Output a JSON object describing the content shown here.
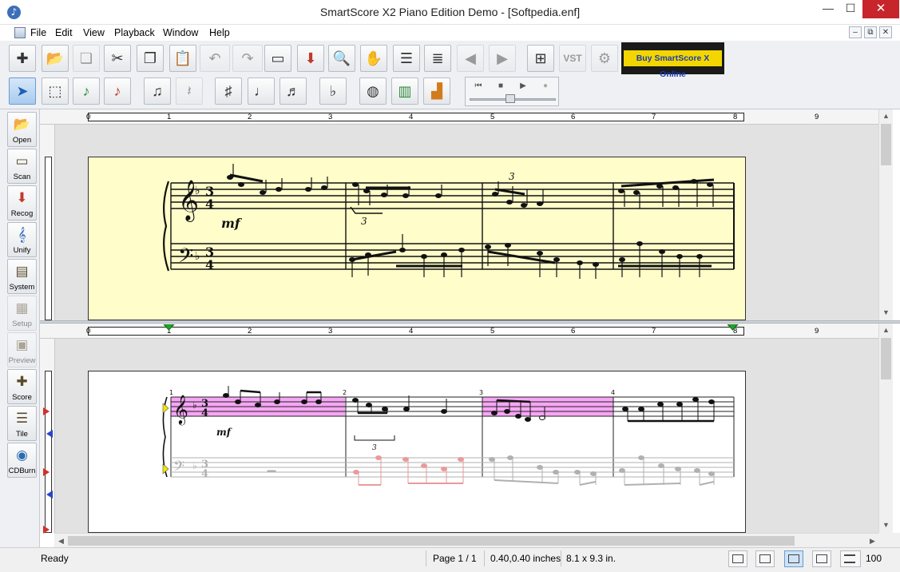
{
  "window": {
    "title": "SmartScore X2 Piano Edition Demo - [Softpedia.enf]",
    "controls": {
      "minimize": "—",
      "maximize": "☐",
      "close": "✕"
    }
  },
  "menu": {
    "items": [
      "File",
      "Edit",
      "View",
      "Playback",
      "Window",
      "Help"
    ],
    "mdi": {
      "minimize": "–",
      "restore": "⧉",
      "close": "✕"
    }
  },
  "toolbar": {
    "row1": [
      {
        "id": "new",
        "icon": "new-score-icon",
        "glyph": "✚"
      },
      {
        "id": "open",
        "icon": "open-folder-icon",
        "glyph": "📂"
      },
      {
        "id": "close",
        "icon": "close-file-icon",
        "glyph": "❏"
      },
      {
        "id": "cut",
        "icon": "scissors-icon",
        "glyph": "✂"
      },
      {
        "id": "copy",
        "icon": "copy-icon",
        "glyph": "❐"
      },
      {
        "id": "paste",
        "icon": "paste-icon",
        "glyph": "📋"
      },
      {
        "id": "undo",
        "icon": "undo-icon",
        "glyph": "↶"
      },
      {
        "id": "redo",
        "icon": "redo-icon",
        "glyph": "↷"
      },
      {
        "id": "scan",
        "icon": "scanner-icon",
        "glyph": "▭"
      },
      {
        "id": "recognize",
        "icon": "recognize-icon",
        "glyph": "⬇"
      },
      {
        "id": "zoom",
        "icon": "magnifier-icon",
        "glyph": "🔍"
      },
      {
        "id": "hand",
        "icon": "hand-icon",
        "glyph": "✋"
      },
      {
        "id": "page-view",
        "icon": "page-view-icon",
        "glyph": "☰"
      },
      {
        "id": "staff-view",
        "icon": "staff-view-icon",
        "glyph": "≣"
      },
      {
        "id": "prev-page",
        "icon": "prev-page-icon",
        "glyph": "◀"
      },
      {
        "id": "next-page",
        "icon": "next-page-icon",
        "glyph": "▶"
      },
      {
        "id": "mixer",
        "icon": "mixer-icon",
        "glyph": "⊞"
      },
      {
        "id": "vst",
        "icon": "vst-icon",
        "glyph": "VST"
      },
      {
        "id": "tuner",
        "icon": "tuner-icon",
        "glyph": "⚙"
      }
    ],
    "row2": [
      {
        "id": "select",
        "icon": "arrow-pointer-icon",
        "glyph": "➤"
      },
      {
        "id": "select-region",
        "icon": "select-region-icon",
        "glyph": "⬚"
      },
      {
        "id": "insert",
        "icon": "insert-note-icon",
        "glyph": "♪"
      },
      {
        "id": "delete",
        "icon": "delete-note-icon",
        "glyph": "♪"
      },
      {
        "id": "notes",
        "icon": "notes-palette-icon",
        "glyph": "♫"
      },
      {
        "id": "rests",
        "icon": "rests-palette-icon",
        "glyph": "𝄽"
      },
      {
        "id": "accidentals",
        "icon": "accidentals-icon",
        "glyph": "♯"
      },
      {
        "id": "durations",
        "icon": "duration-icon",
        "glyph": "♩"
      },
      {
        "id": "tuplets",
        "icon": "tuplet-icon",
        "glyph": "♬"
      },
      {
        "id": "ties",
        "icon": "ties-icon",
        "glyph": "♭"
      },
      {
        "id": "drum",
        "icon": "drum-icon",
        "glyph": "◍"
      },
      {
        "id": "piano-roll",
        "icon": "piano-roll-icon",
        "glyph": "▥"
      },
      {
        "id": "stairs",
        "icon": "stairs-icon",
        "glyph": "▟"
      }
    ],
    "buy_label": "Buy SmartScore X Online",
    "transport": {
      "rewind": "⏮",
      "stop": "■",
      "play": "▶",
      "record": "●"
    }
  },
  "sidebar": [
    {
      "label": "Open",
      "icon": "folder-icon",
      "glyph": "📂",
      "enabled": true
    },
    {
      "label": "Scan",
      "icon": "scanner-icon",
      "glyph": "▭",
      "enabled": true
    },
    {
      "label": "Recog",
      "icon": "recognize-icon",
      "glyph": "⬇",
      "enabled": true
    },
    {
      "label": "Unify",
      "icon": "unify-icon",
      "glyph": "𝄞",
      "enabled": true
    },
    {
      "label": "System",
      "icon": "system-icon",
      "glyph": "▤",
      "enabled": true
    },
    {
      "label": "Setup",
      "icon": "setup-icon",
      "glyph": "▦",
      "enabled": false
    },
    {
      "label": "Preview",
      "icon": "preview-icon",
      "glyph": "▣",
      "enabled": false
    },
    {
      "label": "Score",
      "icon": "score-icon",
      "glyph": "✚",
      "enabled": true
    },
    {
      "label": "Tile",
      "icon": "tile-icon",
      "glyph": "☰",
      "enabled": true
    },
    {
      "label": "CDBurn",
      "icon": "cd-icon",
      "glyph": "◉",
      "enabled": true
    }
  ],
  "ruler": {
    "numbers": [
      "0",
      "1",
      "2",
      "3",
      "4",
      "5",
      "6",
      "7",
      "8",
      "9"
    ]
  },
  "score": {
    "time_signature": {
      "top": "3",
      "bottom": "4"
    },
    "dynamic": "mf",
    "triplet": "3",
    "measure_numbers": [
      "1",
      "2",
      "3",
      "4"
    ]
  },
  "status": {
    "ready": "Ready",
    "page": "Page 1 / 1",
    "position": "0.40,0.40 inches",
    "size": "8.1 x 9.3 in.",
    "zoom": "100"
  },
  "colors": {
    "scan_bg": "#fffdc9",
    "highlight": "#f6a6f4",
    "close_red": "#c7252b",
    "buy_yellow": "#f3d600",
    "left_hand_red": "#e89a9a"
  }
}
